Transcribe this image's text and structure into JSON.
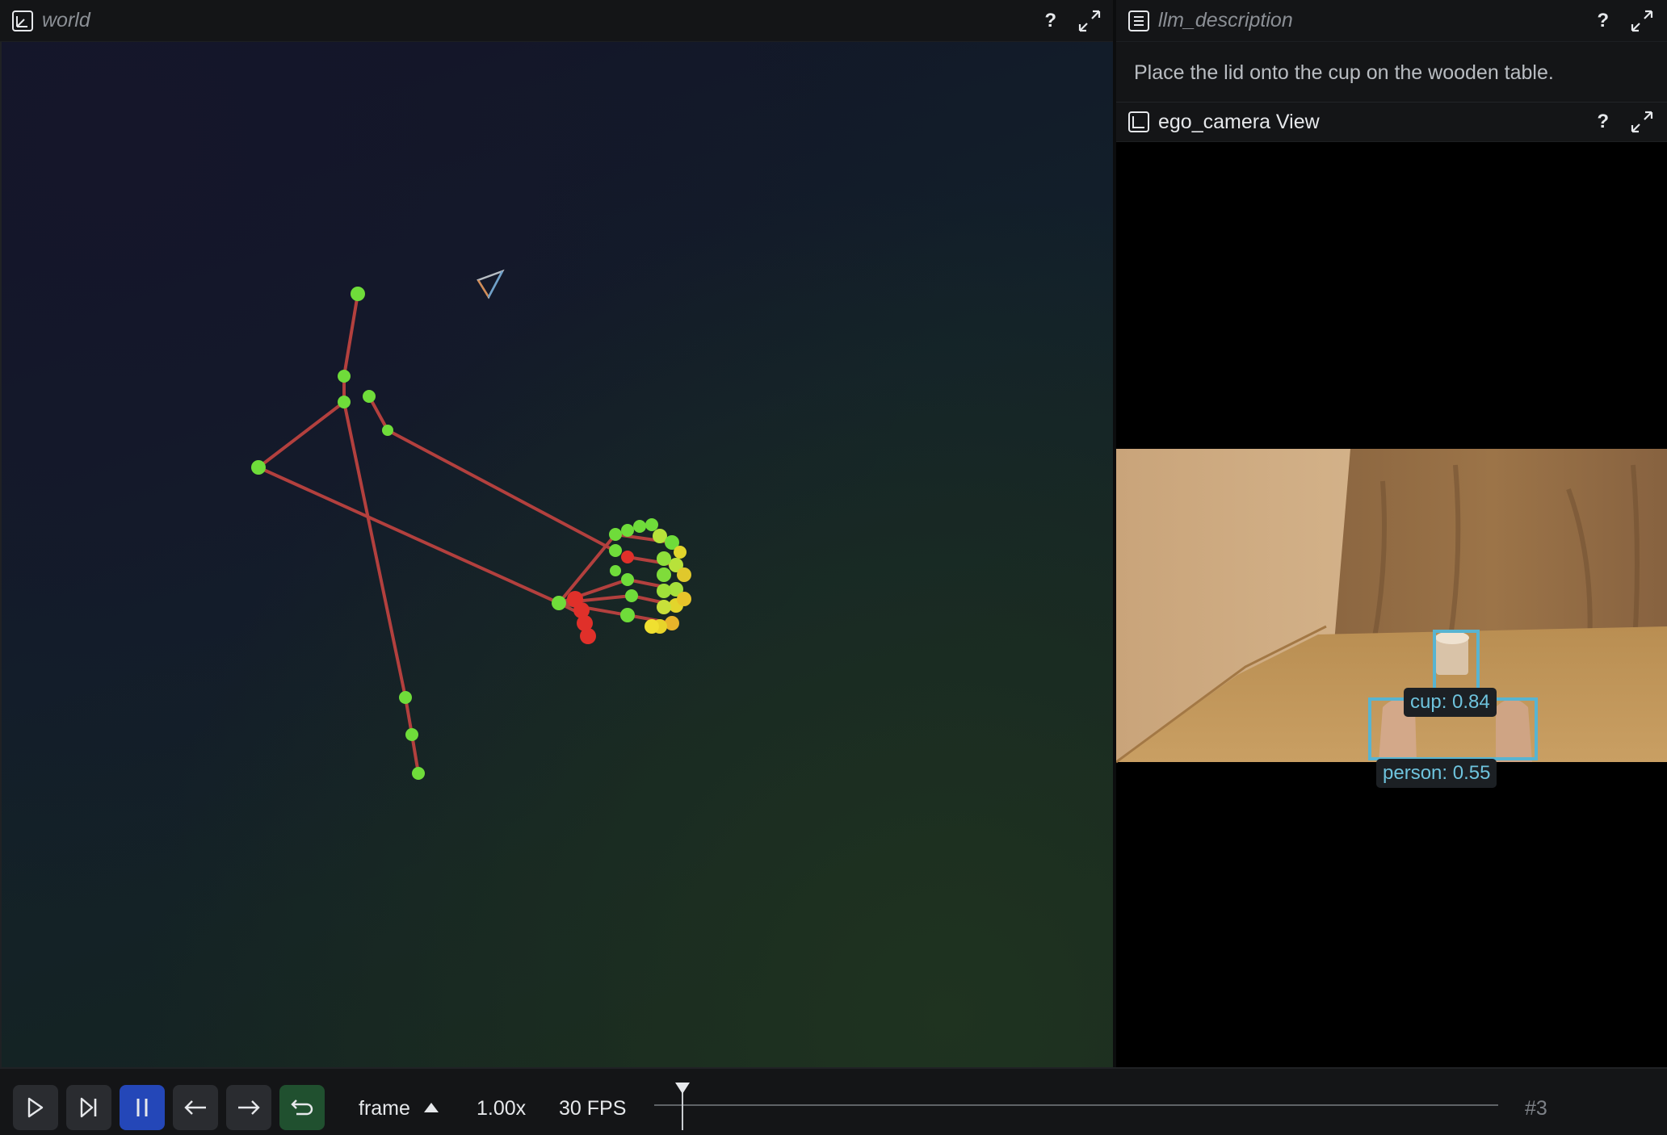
{
  "world": {
    "title": "world",
    "help": "?"
  },
  "llm_description": {
    "title": "llm_description",
    "help": "?",
    "text": "Place the lid onto the cup on the wooden table."
  },
  "ego_camera": {
    "title": "ego_camera View",
    "help": "?",
    "detections": [
      {
        "label": "cup: 0.84"
      },
      {
        "label": "person: 0.55"
      }
    ]
  },
  "timebar": {
    "timeline_name": "frame",
    "speed": "1.00x",
    "fps": "30 FPS",
    "frame_label": "#3"
  },
  "colors": {
    "accent_blue": "#2447b8",
    "loop_green": "#20502f",
    "bbox": "#58b4d1",
    "joint_green": "#6fdc3a",
    "bone_red": "#b3403e"
  }
}
